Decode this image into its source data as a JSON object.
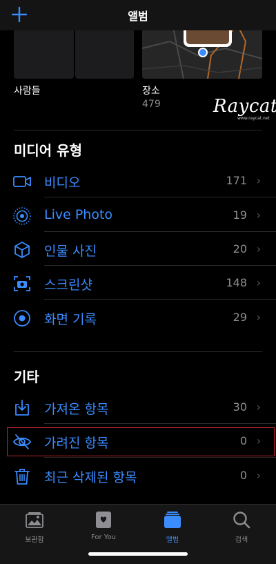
{
  "header": {
    "title": "앨범"
  },
  "thumbs": {
    "people_label": "사람들",
    "places_label": "장소",
    "places_count": "479"
  },
  "watermark": {
    "text": "Raycat",
    "sub": "www.raycat.net"
  },
  "media_types": {
    "title": "미디어 유형",
    "items": [
      {
        "label": "비디오",
        "count": "171",
        "icon": "video-icon"
      },
      {
        "label": "Live Photo",
        "count": "19",
        "icon": "live-photo-icon"
      },
      {
        "label": "인물 사진",
        "count": "20",
        "icon": "cube-icon"
      },
      {
        "label": "스크린샷",
        "count": "148",
        "icon": "screenshot-icon"
      },
      {
        "label": "화면 기록",
        "count": "29",
        "icon": "screen-record-icon"
      }
    ]
  },
  "others": {
    "title": "기타",
    "items": [
      {
        "label": "가져온 항목",
        "count": "30",
        "icon": "import-icon"
      },
      {
        "label": "가려진 항목",
        "count": "0",
        "icon": "hidden-eye-icon"
      },
      {
        "label": "최근 삭제된 항목",
        "count": "0",
        "icon": "trash-icon"
      }
    ]
  },
  "tabs": [
    {
      "label": "보관함",
      "icon": "library-icon",
      "active": false
    },
    {
      "label": "For You",
      "icon": "for-you-icon",
      "active": false
    },
    {
      "label": "앨범",
      "icon": "albums-icon",
      "active": true
    },
    {
      "label": "검색",
      "icon": "search-icon",
      "active": false
    }
  ],
  "colors": {
    "accent": "#3a8cff",
    "highlight_border": "#c0262b"
  }
}
